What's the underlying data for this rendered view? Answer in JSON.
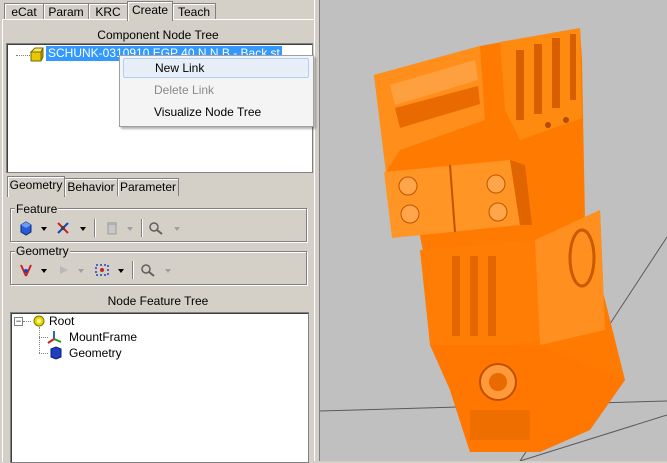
{
  "top_tabs": [
    "eCat",
    "Param",
    "KRC",
    "Create",
    "Teach"
  ],
  "active_top_tab": "Create",
  "component_tree": {
    "title": "Component Node Tree",
    "selected_node": "SCHUNK-0310910 EGP 40 N N B - Back.st"
  },
  "context_menu": {
    "items": [
      {
        "label": "New Link",
        "enabled": true,
        "highlighted": true
      },
      {
        "label": "Delete Link",
        "enabled": false
      },
      {
        "label": "Visualize Node Tree",
        "enabled": true
      }
    ]
  },
  "sub_tabs": [
    "Geometry",
    "Behavior",
    "Parameter"
  ],
  "active_sub_tab": "Geometry",
  "feature_group": {
    "label": "Feature"
  },
  "geometry_group": {
    "label": "Geometry"
  },
  "node_feature_tree": {
    "title": "Node Feature Tree",
    "root": "Root",
    "children": [
      "MountFrame",
      "Geometry"
    ]
  },
  "colors": {
    "part_orange": "#ff7a00",
    "viewport_bg": "#c0c0c0",
    "selection_blue": "#3399ff"
  }
}
